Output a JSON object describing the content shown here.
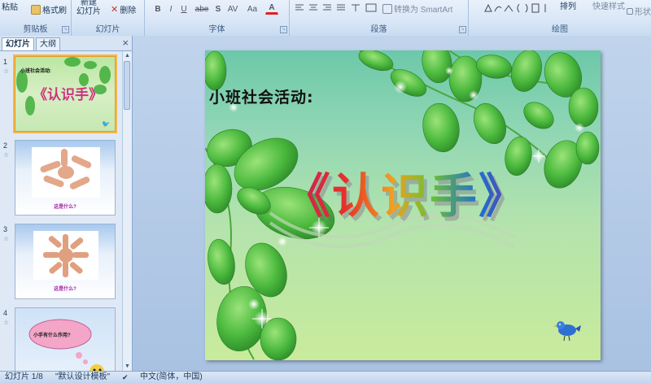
{
  "ribbon": {
    "clipboard": {
      "paste": "粘贴",
      "format_painter": "格式刷",
      "label": "剪贴板"
    },
    "slides": {
      "new_slide_line1": "新建",
      "new_slide_line2": "幻灯片",
      "delete": "删除",
      "label": "幻灯片"
    },
    "font": {
      "bold": "B",
      "italic": "I",
      "underline": "U",
      "strike": "abe",
      "shadow": "S",
      "spacing": "AV",
      "case": "Aa",
      "color": "A",
      "label": "字体"
    },
    "paragraph": {
      "convert_smartart": "转换为 SmartArt",
      "label": "段落"
    },
    "drawing": {
      "arrange": "排列",
      "quick_styles": "快速样式",
      "shape_effects": "形状效",
      "label": "绘图"
    }
  },
  "left_panel": {
    "tab_slides": "幻灯片",
    "tab_outline": "大纲",
    "close": "×",
    "slides": [
      {
        "number": "1",
        "star": "☆",
        "title": "小班社会活动:",
        "big": "《认识手》"
      },
      {
        "number": "2",
        "star": "☆",
        "caption": "这是什么?"
      },
      {
        "number": "3",
        "star": "☆",
        "caption": "这是什么?"
      },
      {
        "number": "4",
        "star": "☆",
        "caption": "小手有什么作用?"
      }
    ]
  },
  "slide": {
    "subtitle": "小班社会活动:",
    "title": "《认识手》"
  },
  "status_bar": {
    "slide_position": "幻灯片 1/8",
    "theme": "\"默认设计模板\"",
    "language": "中文(简体，中国)"
  },
  "colors": {
    "ribbon_bg": "#d5e4f5",
    "slide_green": "#8fd6b4",
    "selection": "#f5b74c"
  }
}
